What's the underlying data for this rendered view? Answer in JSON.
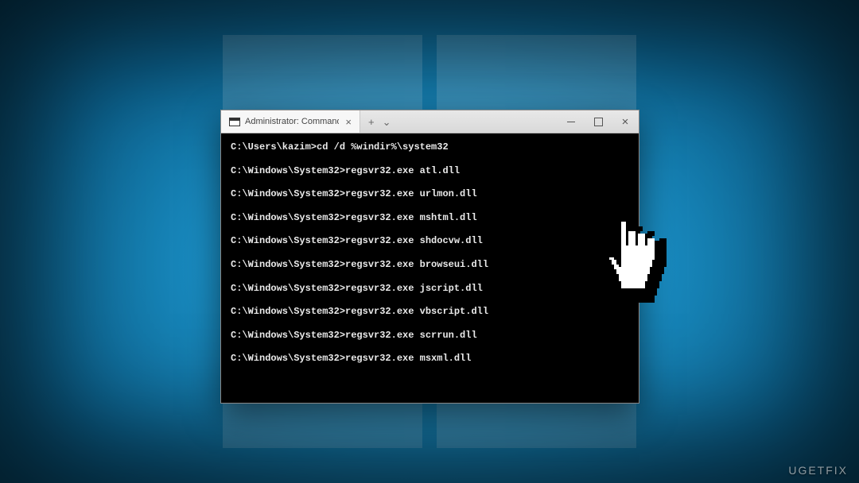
{
  "window": {
    "tab_title": "Administrator: Command Prom",
    "tab_close_glyph": "×",
    "new_tab_glyph": "+",
    "dropdown_glyph": "⌄",
    "close_glyph": "×"
  },
  "terminal": {
    "lines": [
      "C:\\Users\\kazim>cd /d %windir%\\system32",
      "C:\\Windows\\System32>regsvr32.exe atl.dll",
      "C:\\Windows\\System32>regsvr32.exe urlmon.dll",
      "C:\\Windows\\System32>regsvr32.exe mshtml.dll",
      "C:\\Windows\\System32>regsvr32.exe shdocvw.dll",
      "C:\\Windows\\System32>regsvr32.exe browseui.dll",
      "C:\\Windows\\System32>regsvr32.exe jscript.dll",
      "C:\\Windows\\System32>regsvr32.exe vbscript.dll",
      "C:\\Windows\\System32>regsvr32.exe scrrun.dll",
      "C:\\Windows\\System32>regsvr32.exe msxml.dll"
    ]
  },
  "watermark": "UGETFIX"
}
